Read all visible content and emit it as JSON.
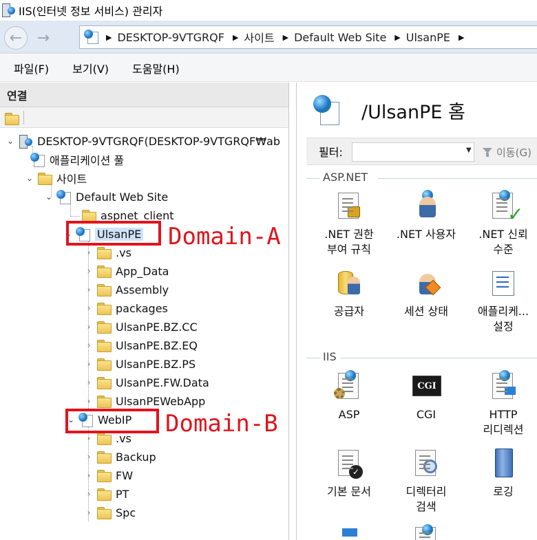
{
  "window": {
    "title": "IIS(인터넷 정보 서비스) 관리자"
  },
  "address": {
    "crumbs": [
      "DESKTOP-9VTGRQF",
      "사이트",
      "Default Web Site",
      "UlsanPE"
    ]
  },
  "menu": {
    "items": [
      "파일(F)",
      "보기(V)",
      "도움말(H)"
    ]
  },
  "connections": {
    "header": "연결",
    "tree": {
      "server": "DESKTOP-9VTGRQF(DESKTOP-9VTGRQF₩ab",
      "app_pools": "애플리케이션 풀",
      "sites": "사이트",
      "default_site": "Default Web Site",
      "aspnet_client": "aspnet_client",
      "ulsanpe": "UlsanPE",
      "ulsanpe_children": [
        ".vs",
        "App_Data",
        "Assembly",
        "packages",
        "UlsanPE.BZ.CC",
        "UlsanPE.BZ.EQ",
        "UlsanPE.BZ.PS",
        "UlsanPE.FW.Data",
        "UlsanPEWebApp"
      ],
      "webip": "WebIP",
      "webip_children": [
        ".vs",
        "Backup",
        "FW",
        "PT",
        "Spc"
      ]
    }
  },
  "annotations": {
    "domain_a": "Domain-A",
    "domain_b": "Domain-B"
  },
  "home": {
    "title": "/UlsanPE 홈",
    "filter_label": "필터:",
    "go_label": "이동(G)",
    "groups": {
      "aspnet": {
        "title": "ASP.NET",
        "items": [
          {
            "label1": ".NET 권한",
            "label2": "부여 규칙"
          },
          {
            "label1": ".NET 사용자",
            "label2": ""
          },
          {
            "label1": ".NET 신뢰",
            "label2": "수준"
          },
          {
            "label1": "공급자",
            "label2": ""
          },
          {
            "label1": "세션 상태",
            "label2": ""
          },
          {
            "label1": "애플리케...",
            "label2": "설정"
          }
        ]
      },
      "iis": {
        "title": "IIS",
        "items": [
          {
            "label1": "ASP",
            "label2": ""
          },
          {
            "label1": "CGI",
            "label2": ""
          },
          {
            "label1": "HTTP",
            "label2": "리디렉션"
          },
          {
            "label1": "기본 문서",
            "label2": ""
          },
          {
            "label1": "디렉터리",
            "label2": "검색"
          },
          {
            "label1": "로깅",
            "label2": ""
          }
        ]
      }
    }
  },
  "colors": {
    "annotation": "#e0141d",
    "selection": "#cfe3f8",
    "address_bg": "#dfe8f3"
  }
}
